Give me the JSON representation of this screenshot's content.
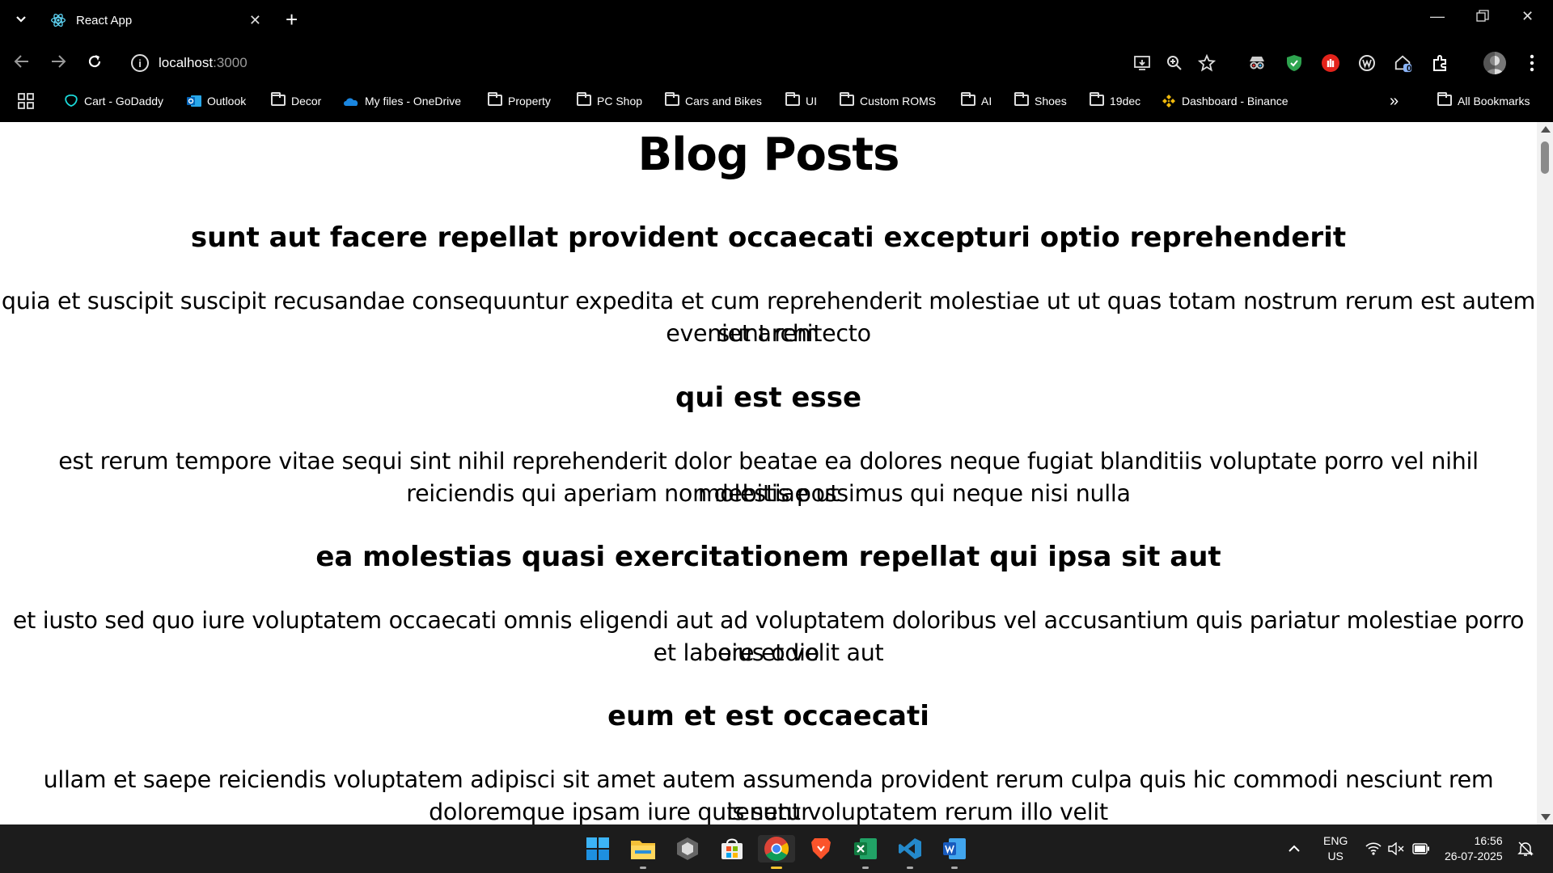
{
  "browser": {
    "tab_title": "React App",
    "address_host": "localhost",
    "address_port": ":3000",
    "extension_badge": "0",
    "bookmarks": [
      {
        "label": "Cart - GoDaddy",
        "icon": "godaddy-icon"
      },
      {
        "label": "Outlook",
        "icon": "outlook-icon"
      },
      {
        "label": "Decor",
        "icon": "folder-icon"
      },
      {
        "label": "My files - OneDrive",
        "icon": "onedrive-icon"
      },
      {
        "label": "Property",
        "icon": "folder-icon"
      },
      {
        "label": "PC Shop",
        "icon": "folder-icon"
      },
      {
        "label": "Cars and Bikes",
        "icon": "folder-icon"
      },
      {
        "label": "UI",
        "icon": "folder-icon"
      },
      {
        "label": "Custom ROMS",
        "icon": "folder-icon"
      },
      {
        "label": "AI",
        "icon": "folder-icon"
      },
      {
        "label": "Shoes",
        "icon": "folder-icon"
      },
      {
        "label": "19dec",
        "icon": "folder-icon"
      },
      {
        "label": "Dashboard - Binance",
        "icon": "binance-icon"
      }
    ],
    "more_bookmarks": "»",
    "all_bookmarks": "All Bookmarks"
  },
  "page": {
    "heading": "Blog Posts",
    "posts": [
      {
        "title": "sunt aut facere repellat provident occaecati excepturi optio reprehenderit",
        "body_line1": "quia et suscipit suscipit recusandae consequuntur expedita et cum reprehenderit molestiae ut ut quas totam nostrum rerum est autem sunt rem",
        "body_line2": "eveniet architecto"
      },
      {
        "title": "qui est esse",
        "body_line1": "est rerum tempore vitae sequi sint nihil reprehenderit dolor beatae ea dolores neque fugiat blanditiis voluptate porro vel nihil molestiae ut",
        "body_line2": "reiciendis qui aperiam non debitis possimus qui neque nisi nulla"
      },
      {
        "title": "ea molestias quasi exercitationem repellat qui ipsa sit aut",
        "body_line1": "et iusto sed quo iure voluptatem occaecati omnis eligendi aut ad voluptatem doloribus vel accusantium quis pariatur molestiae porro eius odio",
        "body_line2": "et labore et velit aut"
      },
      {
        "title": "eum et est occaecati",
        "body_line1": "ullam et saepe reiciendis voluptatem adipisci sit amet autem assumenda provident rerum culpa quis hic commodi nesciunt rem tenetur",
        "body_line2": "doloremque ipsam iure quis sunt voluptatem rerum illo velit"
      }
    ]
  },
  "taskbar": {
    "language": "ENG",
    "region": "US",
    "time": "16:56",
    "date": "26-07-2025",
    "apps": [
      "windows-start-icon",
      "file-explorer-icon",
      "unity-icon",
      "microsoft-store-icon",
      "chrome-icon",
      "brave-icon",
      "excel-icon",
      "vscode-icon",
      "word-icon"
    ]
  },
  "colors": {
    "chrome_bg": "#000000",
    "page_bg": "#ffffff",
    "taskbar_bg": "#1c1c1c"
  }
}
